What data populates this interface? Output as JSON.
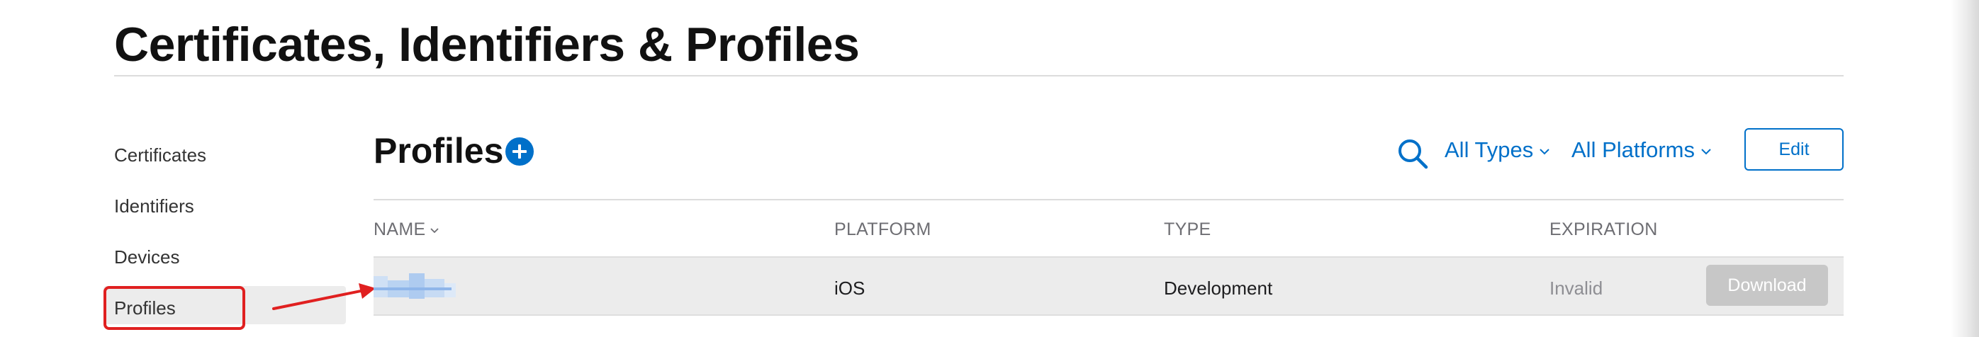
{
  "header": {
    "title": "Certificates, Identifiers & Profiles"
  },
  "sidebar": {
    "items": [
      {
        "label": "Certificates"
      },
      {
        "label": "Identifiers"
      },
      {
        "label": "Devices"
      },
      {
        "label": "Profiles",
        "selected": true
      }
    ]
  },
  "main": {
    "title": "Profiles",
    "filters": {
      "types": "All Types",
      "platforms": "All Platforms"
    },
    "edit_label": "Edit",
    "table": {
      "columns": [
        "NAME",
        "PLATFORM",
        "TYPE",
        "EXPIRATION"
      ],
      "rows": [
        {
          "name": "",
          "platform": "iOS",
          "type": "Development",
          "expiration": "Invalid",
          "action": "Download"
        }
      ]
    }
  },
  "colors": {
    "accent": "#0070c9",
    "annotation": "#e02020",
    "row_background": "#ececec",
    "disabled_button": "#c7c7c7"
  },
  "icons": [
    "plus-circle-icon",
    "search-icon",
    "chevron-down-icon"
  ]
}
